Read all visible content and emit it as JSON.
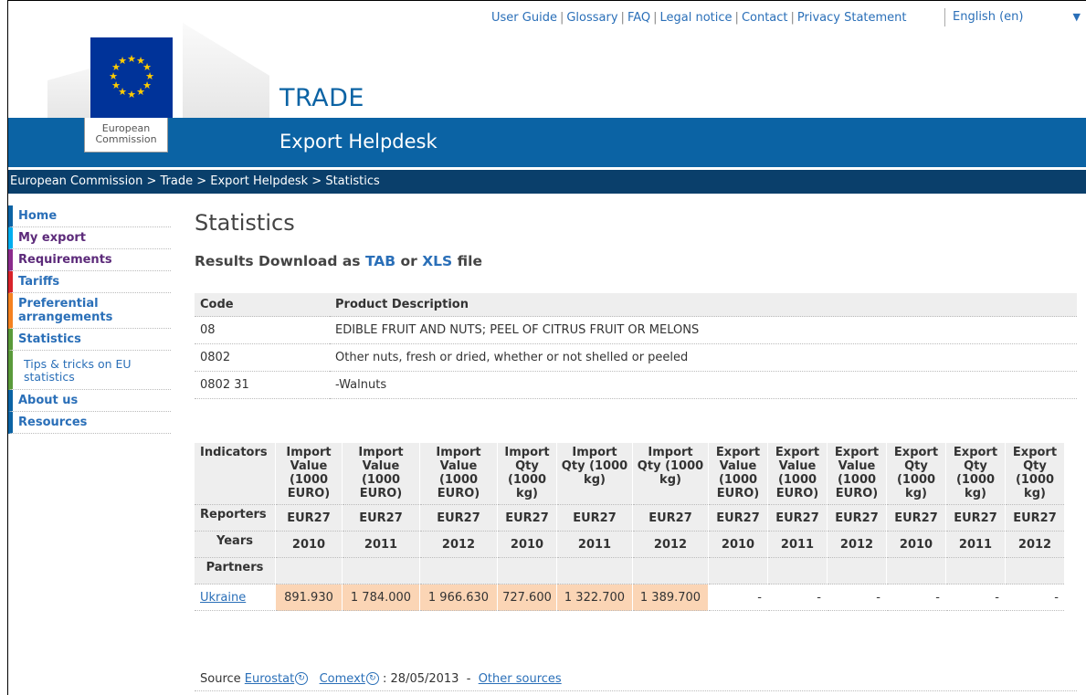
{
  "top_links": [
    "User Guide",
    "Glossary",
    "FAQ",
    "Legal notice",
    "Contact",
    "Privacy Statement"
  ],
  "language": "English (en)",
  "header": {
    "brand": "TRADE",
    "subbrand": "Export Helpdesk",
    "logo_label_1": "European",
    "logo_label_2": "Commission"
  },
  "breadcrumb": "European Commission > Trade > Export Helpdesk > Statistics",
  "sidebar": {
    "items": [
      "Home",
      "My export",
      "Requirements",
      "Tariffs",
      "Preferential arrangements",
      "Statistics",
      "Tips & tricks on EU statistics",
      "About us",
      "Resources"
    ]
  },
  "main": {
    "title": "Statistics",
    "results_prefix": "Results Download as",
    "tab_link": "TAB",
    "or": "or",
    "xls_link": "XLS",
    "file": "file"
  },
  "product_table": {
    "headers": [
      "Code",
      "Product Description"
    ],
    "rows": [
      [
        "08",
        "EDIBLE FRUIT AND NUTS; PEEL OF CITRUS FRUIT OR MELONS"
      ],
      [
        "0802",
        "Other nuts, fresh or dried, whether or not shelled or peeled"
      ],
      [
        "0802 31",
        "-Walnuts"
      ]
    ]
  },
  "stats_table": {
    "indicators_label": "Indicators",
    "indicators": [
      "Import Value (1000 EURO)",
      "Import Value (1000 EURO)",
      "Import Value (1000 EURO)",
      "Import Qty (1000 kg)",
      "Import Qty (1000 kg)",
      "Import Qty (1000 kg)",
      "Export Value (1000 EURO)",
      "Export Value (1000 EURO)",
      "Export Value (1000 EURO)",
      "Export Qty (1000 kg)",
      "Export Qty (1000 kg)",
      "Export Qty (1000 kg)"
    ],
    "reporters_label": "Reporters",
    "reporter": "EUR27",
    "years_label": "Years",
    "years": [
      "2010",
      "2011",
      "2012",
      "2010",
      "2011",
      "2012",
      "2010",
      "2011",
      "2012",
      "2010",
      "2011",
      "2012"
    ],
    "partners_label": "Partners",
    "partner": "Ukraine",
    "values": [
      "891.930",
      "1 784.000",
      "1 966.630",
      "727.600",
      "1 322.700",
      "1 389.700",
      "-",
      "-",
      "-",
      "-",
      "-",
      "-"
    ]
  },
  "source": {
    "label": "Source",
    "eurostat": "Eurostat",
    "comext": "Comext",
    "date": ": 28/05/2013",
    "dash": "-",
    "other": "Other sources"
  }
}
